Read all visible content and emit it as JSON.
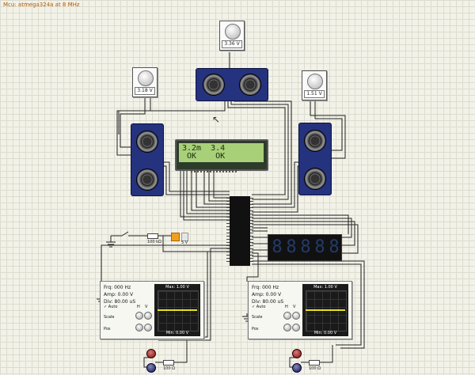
{
  "window": {
    "title": "Mcu: atmega324a at 8 MHz"
  },
  "knobs": [
    {
      "value": "3.36 V"
    },
    {
      "value": "3.18 V"
    },
    {
      "value": "1.51 V"
    }
  ],
  "lcd": {
    "line1": "3.2m  3.4",
    "line2": " OK    OK"
  },
  "seven_segment": {
    "digits": [
      "8",
      "8",
      "8",
      "8",
      "8"
    ]
  },
  "resistor_labels": {
    "input": "100 kΩ",
    "supply": "5 V",
    "led_left": "100 Ω",
    "led_right": "100 Ω"
  },
  "scopes": [
    {
      "freq": "Frq: 000 Hz",
      "amp": "Amp: 0.00 V",
      "div": "Div: 80.00 uS",
      "auto": "Auto",
      "ch_h": "H",
      "ch_v": "V",
      "scale": "Scale",
      "pos": "Pos",
      "max": "Max: 1.00 V",
      "min": "Min: 0.00 V"
    },
    {
      "freq": "Frq: 000 Hz",
      "amp": "Amp: 0.00 V",
      "div": "Div: 80.00 uS",
      "auto": "Auto",
      "ch_h": "H",
      "ch_v": "V",
      "scale": "Scale",
      "pos": "Pos",
      "max": "Max: 1.00 V",
      "min": "Min: 0.00 V"
    }
  ],
  "colors": {
    "wire": "#222222",
    "sonar": "#25327e",
    "lcd_bg": "#a8d078",
    "trace": "#e8e020"
  },
  "icons": [
    "potentiometer-icon",
    "ultrasonic-sensor-icon",
    "led-icon",
    "ground-icon",
    "cursor-icon"
  ]
}
